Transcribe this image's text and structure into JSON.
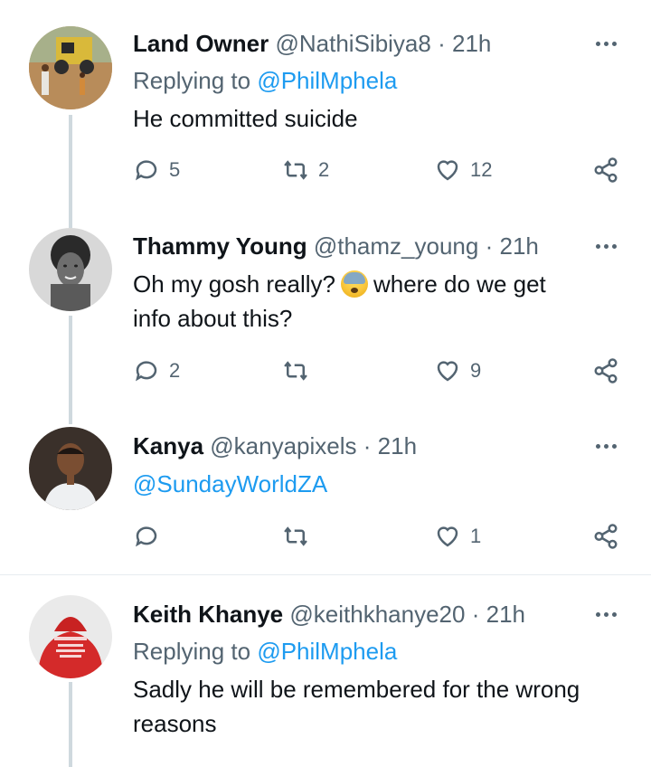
{
  "tweets": [
    {
      "name": "Land Owner",
      "handle": "@NathiSibiya8",
      "dot": "·",
      "time": "21h",
      "replying_label": "Replying to",
      "replying_to": "@PhilMphela",
      "text": "He committed suicide",
      "replies": "5",
      "retweets": "2",
      "likes": "12"
    },
    {
      "name": "Thammy Young",
      "handle": "@thamz_young",
      "dot": "·",
      "time": "21h",
      "text_before": "Oh my gosh really?",
      "emoji": "anxious-face-with-sweat",
      "text_after": "where do we get",
      "text_line2": "info about this?",
      "replies": "2",
      "retweets": "",
      "likes": "9"
    },
    {
      "name": "Kanya",
      "handle": "@kanyapixels",
      "dot": "·",
      "time": "21h",
      "text_mention": "@SundayWorldZA",
      "replies": "",
      "retweets": "",
      "likes": "1"
    },
    {
      "name": "Keith Khanye",
      "handle": "@keithkhanye20",
      "dot": "·",
      "time": "21h",
      "replying_label": "Replying to",
      "replying_to": "@PhilMphela",
      "text_line1": "Sadly he will be remembered for the wrong",
      "text_line2": "reasons"
    }
  ],
  "colors": {
    "link": "#1d9bf0",
    "secondary": "#536471",
    "primary": "#0f1419",
    "thread_line": "#cfd9de"
  },
  "icons": [
    "reply-icon",
    "retweet-icon",
    "like-icon",
    "share-icon",
    "more-icon"
  ]
}
